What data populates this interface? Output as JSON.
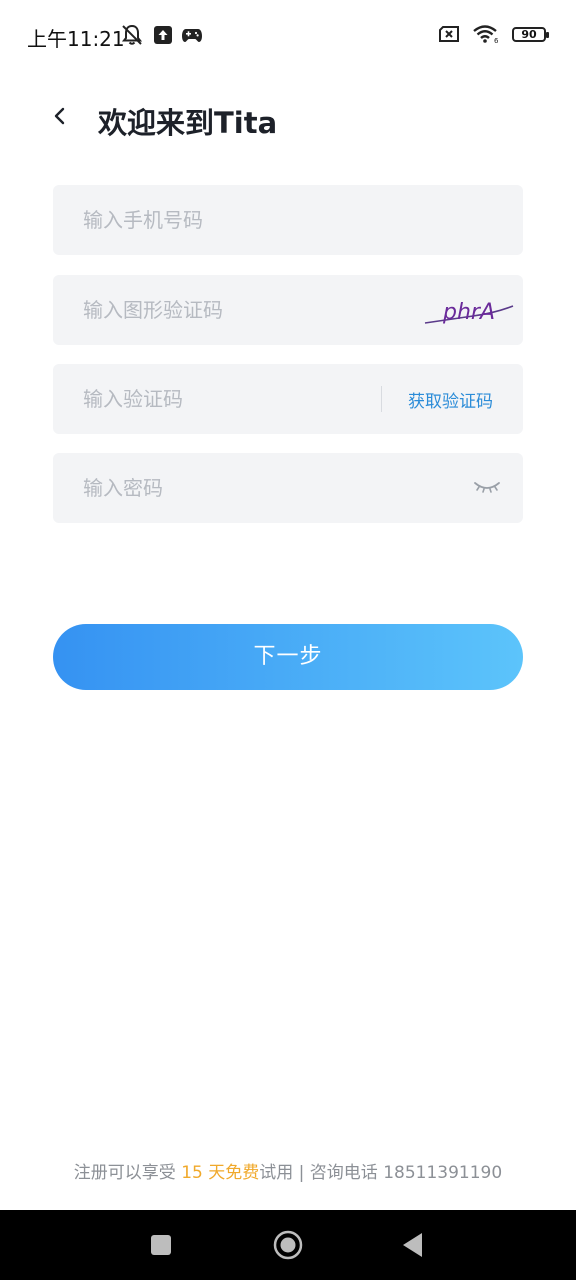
{
  "status_bar": {
    "time": "上午11:21",
    "battery": "90",
    "icons": [
      "notifications-off-icon",
      "upload-icon",
      "gamepad-icon",
      "sim-error-icon",
      "wifi-icon",
      "battery-icon"
    ]
  },
  "header": {
    "title": "欢迎来到Tita",
    "back_icon": "chevron-left-icon"
  },
  "form": {
    "phone_placeholder": "输入手机号码",
    "captcha_placeholder": "输入图形验证码",
    "captcha_text": "phrA",
    "sms_placeholder": "输入验证码",
    "get_code_label": "获取验证码",
    "password_placeholder": "输入密码",
    "eye_icon": "eye-closed-icon"
  },
  "actions": {
    "next_label": "下一步"
  },
  "footer": {
    "prefix": "注册可以享受",
    "highlight": " 15 天免费",
    "suffix": "试用 | 咨询电话 ",
    "phone": "18511391190",
    "highlight_color": "#f0a92b"
  },
  "colors": {
    "accent_start": "#3592f2",
    "accent_end": "#5cc4fb",
    "link": "#2b8cd8",
    "field_bg": "#f3f4f6"
  }
}
